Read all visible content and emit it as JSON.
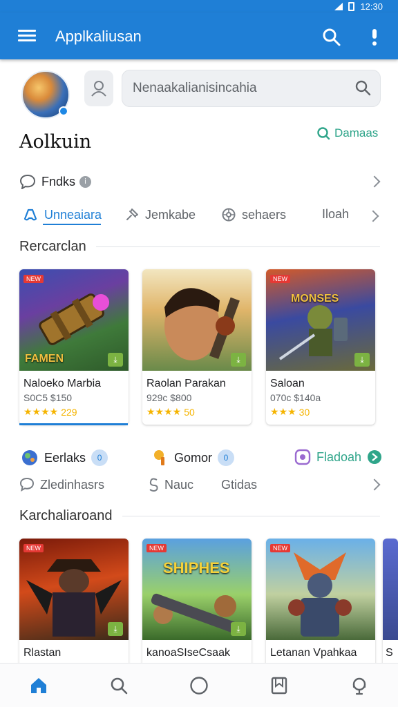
{
  "status_bar": {
    "time": "12:30"
  },
  "app_bar": {
    "title": "Applkaliusan",
    "search_icon": "search-icon",
    "more_icon": "more-vert-icon",
    "menu_icon": "menu-icon",
    "color": "#1f7fd6"
  },
  "header": {
    "search_placeholder": "Nenaakalianisincahia",
    "profile_title": "Aolkuin",
    "games_link": "Damaas"
  },
  "friends_row": {
    "label": "Fndks"
  },
  "tabs": [
    {
      "label": "Unneaiara",
      "icon": "controller-icon"
    },
    {
      "label": "Jemkabe",
      "icon": "pin-icon"
    },
    {
      "label": "sehaers",
      "icon": "settings-icon"
    },
    {
      "label": "Iloah",
      "icon": ""
    }
  ],
  "section1": {
    "title": "Rercarclan"
  },
  "cards1": [
    {
      "overlay": "FAMEN",
      "badge": "NEW",
      "name": "Naloeko Marbia",
      "price": "S0C5  $150",
      "rating": "229"
    },
    {
      "overlay": "",
      "badge": "",
      "name": "Raolan Parakan",
      "price": "929c  $800",
      "rating": "50"
    },
    {
      "overlay": "MONSES",
      "badge": "NEW",
      "name": "Saloan",
      "price": "070c  $140a",
      "rating": "30"
    }
  ],
  "categories": [
    {
      "label": "Eerlaks",
      "count": "0"
    },
    {
      "label": "Gomor",
      "count": "0"
    },
    {
      "label": "Fladoah",
      "count": ""
    }
  ],
  "links_row": [
    {
      "label": "Zledinhasrs"
    },
    {
      "label": "Nauc"
    },
    {
      "label": "Gtidas"
    }
  ],
  "section2": {
    "title": "Karchaliaroand"
  },
  "cards2": [
    {
      "badge": "NEW",
      "name": "Rlastan"
    },
    {
      "badge": "NEW",
      "name": "kanoaSIseCsaak",
      "overlay": "SHIPHES"
    },
    {
      "badge": "NEW",
      "name": "Letanan Vpahkaa"
    },
    {
      "badge": "",
      "name": "S"
    }
  ],
  "bottom_nav": [
    {
      "icon": "home-icon"
    },
    {
      "icon": "search-icon"
    },
    {
      "icon": "circle-icon"
    },
    {
      "icon": "bookmark-icon"
    },
    {
      "icon": "support-icon"
    }
  ]
}
